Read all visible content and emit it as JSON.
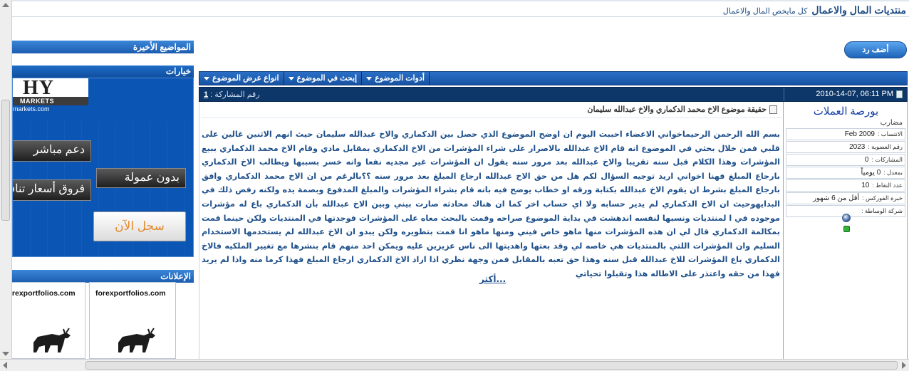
{
  "header": {
    "site_title": "منتديات المال والاعمال",
    "tagline": "كل مايخص المال والاعمال"
  },
  "actions": {
    "reply_button": "أضف رد"
  },
  "toolbar": {
    "thread_tools": "أدوات الموضوع",
    "search_thread": "إبحث في الموضوع",
    "display_modes": "انواع عرض الموضوع"
  },
  "post": {
    "date": "2010-14-07, 06:11 PM",
    "post_number_label": "رقم المشاركة :",
    "post_number": "1",
    "title": "حقيقة موضوع الاخ محمد الدكماري والاخ عبدالله سليمان",
    "body": "بسم الله الرحمن الرحيماخواني الاعضاء احببت اليوم ان اوضح الموضوع الذي حصل بين الدكماري والاخ عبدالله سليمان حيث انهم الاثنين غالين على قلبي فمن خلال بحثي في الموضوع انه قام الاخ عبدالله بالاصرار على شراء المؤشرات من الاخ الدكماري بمقابل مادي وقام الاخ محمد الدكماري ببيع المؤشرات وهذا الكلام قبل سنه تقريبا والاخ عبدالله بعد مرور سنه يقول ان المؤشرات غير مجديه نفعا وانه خسر بسببها ويطالب الاخ الدكماري بارجاع المبلغ فهنا اخواني اريد توجيه السؤال لكم هل من حق الاخ عبدالله ارجاع المبلغ بعد مرور سنه ؟؟بالرغم من ان الاخ محمد الدكماري وافق بارجاع المبلغ بشرط ان يقوم الاخ عبدالله بكتابة ورقه او خطاب يوضح فيه بانه قام بشراء المؤشرات والمبلغ المدفوع وبصمة يده ولكنه رفض ذلك في البدايهوحيث ان الاخ الدكماري لم يدير حسابه ولا اي حساب اخر كما ان هناك محادثه صارت بيني وبين الاخ عبدالله بأن الدكماري باع له مؤشرات موجوده في ا لمنتديات ونسبها لنفسه اندهشت في بداية الموضوع صراحه وقمت بالبحث معاه على المؤشرات فوجدتها في المنتديات ولكن حينما قمت بمكالمة الدكماري قال لي ان هذه المؤشرات منها ماهو خاص فيني ومنها ماهو انا قمت بتطويره ولكن يبدو ان الاخ عبدالله لم يستخدمها الاستخدام السليم وان المؤشرات اللتي بالمنتديات هي خاصه لي وقد بعتها واهديتها الى ناس عزيزين عليه ويمكن احد منهم قام بنشرها مع تغيير الملكيه فالاخ الدكماري باع المؤشرات للاخ عبدالله قبل سنه وهذا حق تعبه بالمقابل فمن وجهة نظري اذا اراد الاخ الدكماري ارجاع المبلغ فهذا كرما منه واذا لم يريد فهذا من حقه واعتذر على الاطاله هذا وتقبلوا تحياتي",
    "more_link": "أكثر..."
  },
  "user": {
    "name": "بورصة العملات",
    "title": "مضارب",
    "info": [
      {
        "label": "الانتساب :",
        "value": "Feb 2009"
      },
      {
        "label": "رقم العضوية :",
        "value": "2023"
      },
      {
        "label": "المشاركات :",
        "value": "0"
      },
      {
        "label": "بمعدل :",
        "value": "0 يومياً"
      },
      {
        "label": "عدد النقاط :",
        "value": "10"
      },
      {
        "label": "خبرة الفوركس :",
        "value": "أقل من 6 شهور"
      },
      {
        "label": "شركة الوساطة :",
        "value": ""
      }
    ]
  },
  "sidebar": {
    "latest_topics": "المواضيع الأخيرة",
    "options": "خيارات",
    "ads": "الإعلانات"
  },
  "banner": {
    "logo": "HY",
    "logo_sub": "MARKETS",
    "logo_url": "markets.com",
    "chip_support": "دعم مباشر",
    "chip_no_commission": "بدون عمولة",
    "chip_spreads": "فروق أسعار تنافسية",
    "cta": "سجل الآن"
  },
  "ads": [
    {
      "label": "forexportfolios.com"
    },
    {
      "label": "forexportfolios.com"
    }
  ],
  "colors": {
    "brand_blue": "#1b4b84",
    "toolbar_blue": "#1753a4",
    "post_header": "#0e3769",
    "post_text": "#1d4f8a",
    "username": "#1540a8",
    "status_online": "#35b23a"
  }
}
